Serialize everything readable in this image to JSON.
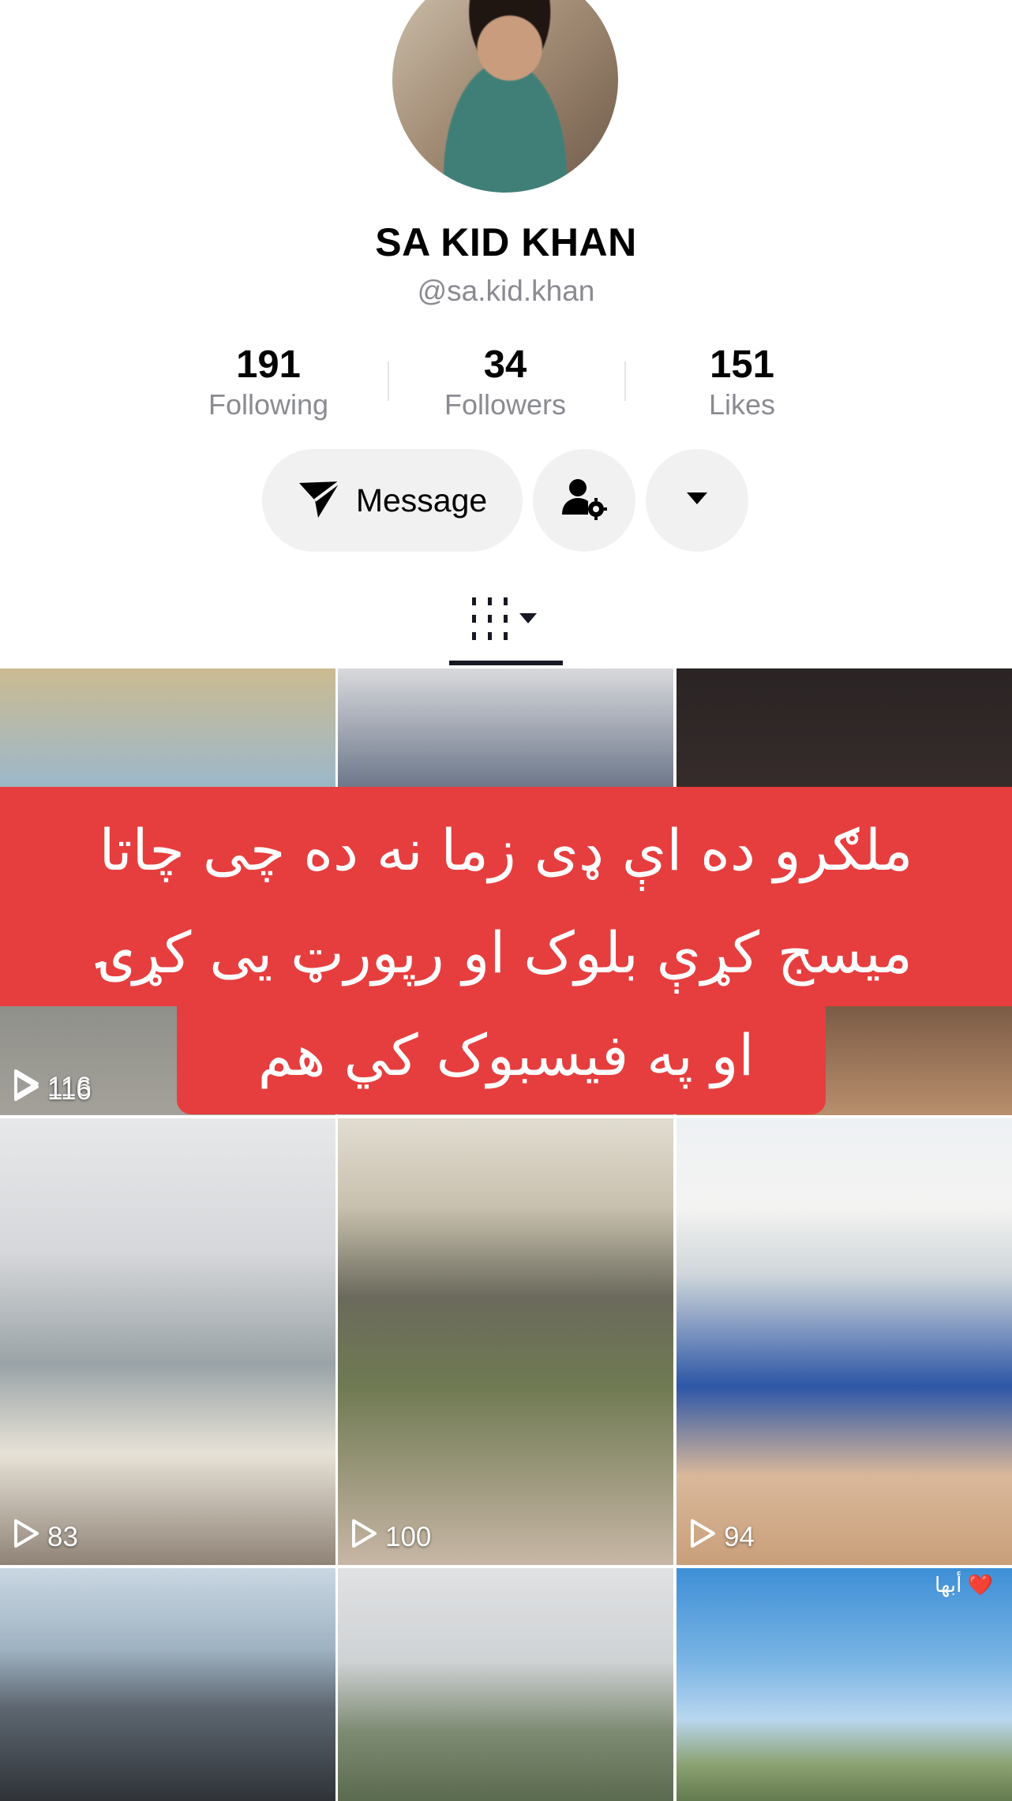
{
  "profile": {
    "display_name": "SA KID KHAN",
    "handle": "@sa.kid.khan"
  },
  "stats": [
    {
      "value": "191",
      "label": "Following"
    },
    {
      "value": "34",
      "label": "Followers"
    },
    {
      "value": "151",
      "label": "Likes"
    }
  ],
  "actions": {
    "message_label": "Message",
    "add_friend_icon": "person-gear-icon",
    "more_icon": "caret-down-icon"
  },
  "tabs": {
    "active_icon": "videos-grid-icon"
  },
  "overlay_text": {
    "line1": "ملګرو ده اې ډی زما نه ده چی چاتا",
    "line2": "میسج کړې بلوک او رپورټ یی کړۍ",
    "line3": "او په فیسبوک کي هم"
  },
  "videos": [
    {
      "plays": "116"
    },
    {
      "plays": ""
    },
    {
      "plays": ""
    },
    {
      "plays": "83"
    },
    {
      "plays": "100"
    },
    {
      "plays": "94"
    },
    {
      "plays": "",
      "caption": "أبها ❤️"
    }
  ],
  "colors": {
    "accent_red": "#e63e3e",
    "text_primary": "#161823",
    "text_secondary": "#8a8b91",
    "button_bg": "#f1f1f2"
  }
}
